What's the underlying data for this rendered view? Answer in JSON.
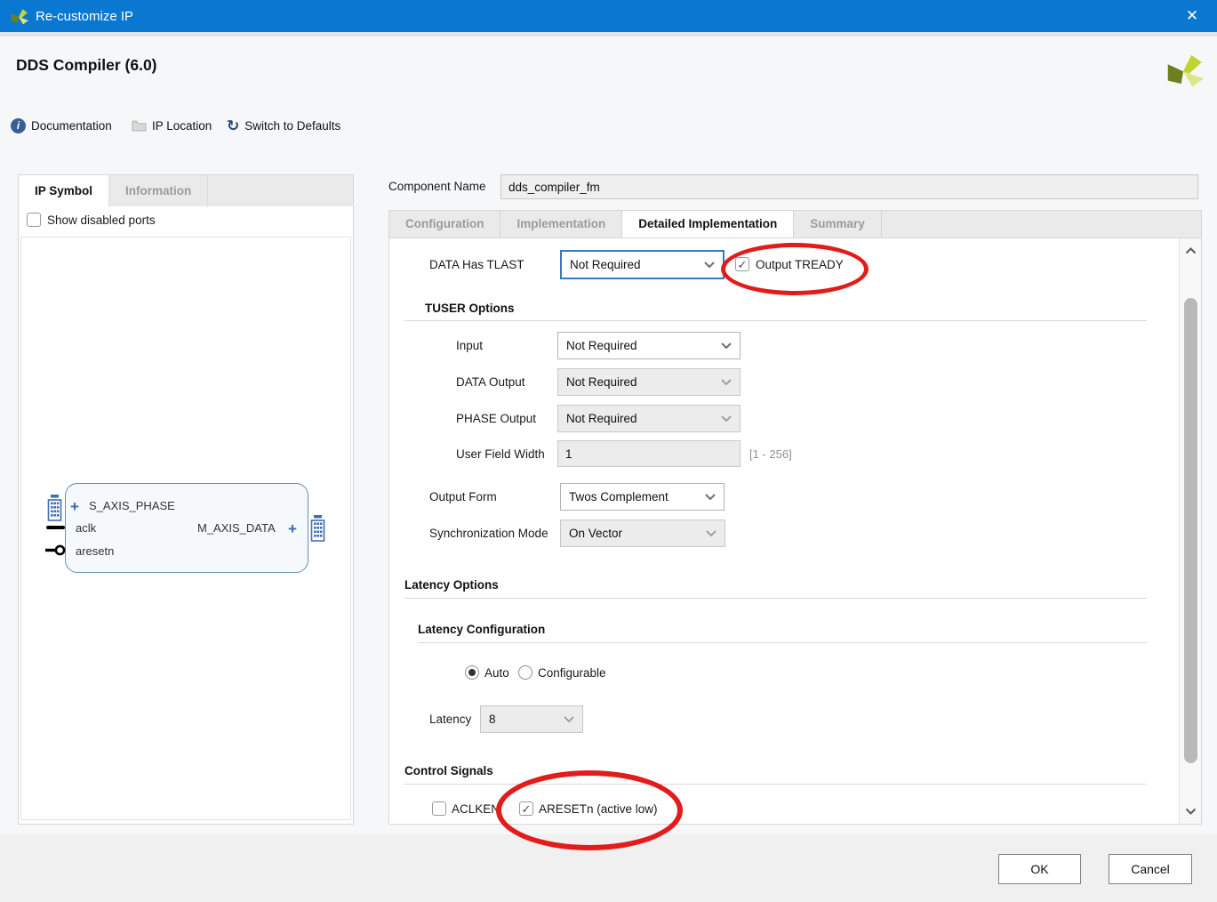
{
  "titlebar": {
    "title": "Re-customize IP"
  },
  "icons": {
    "close": "✕",
    "info": "i",
    "refresh": "↻",
    "plus": "+",
    "check": "✓"
  },
  "header": {
    "title": "DDS Compiler (6.0)"
  },
  "toolbar": {
    "documentation": "Documentation",
    "ip_location": "IP Location",
    "switch_to_defaults": "Switch to Defaults"
  },
  "left_panel": {
    "tabs": [
      {
        "label": "IP Symbol"
      },
      {
        "label": "Information"
      }
    ],
    "show_disabled_ports": "Show disabled ports",
    "ip_symbol": {
      "port_s_axis_phase": "S_AXIS_PHASE",
      "port_aclk": "aclk",
      "port_aresetn": "aresetn",
      "port_m_axis_data": "M_AXIS_DATA"
    }
  },
  "component_name": {
    "label": "Component Name",
    "value": "dds_compiler_fm"
  },
  "config_tabs": [
    {
      "label": "Configuration"
    },
    {
      "label": "Implementation"
    },
    {
      "label": "Detailed Implementation"
    },
    {
      "label": "Summary"
    }
  ],
  "form": {
    "data_has_tlast": {
      "label": "DATA Has TLAST",
      "value": "Not Required"
    },
    "output_tready": {
      "label": "Output TREADY",
      "checked": true
    },
    "tuser_options": {
      "title": "TUSER Options",
      "input": {
        "label": "Input",
        "value": "Not Required"
      },
      "data_output": {
        "label": "DATA Output",
        "value": "Not Required"
      },
      "phase_output": {
        "label": "PHASE Output",
        "value": "Not Required"
      },
      "user_field_width": {
        "label": "User Field Width",
        "value": "1",
        "range": "[1 - 256]"
      }
    },
    "output_form": {
      "label": "Output Form",
      "value": "Twos Complement"
    },
    "synchronization_mode": {
      "label": "Synchronization Mode",
      "value": "On Vector"
    },
    "latency_options": {
      "title": "Latency Options",
      "latency_configuration": {
        "title": "Latency Configuration",
        "auto_label": "Auto",
        "configurable_label": "Configurable",
        "selected": "Auto"
      },
      "latency": {
        "label": "Latency",
        "value": "8"
      }
    },
    "control_signals": {
      "title": "Control Signals",
      "aclken": {
        "label": "ACLKEN",
        "checked": false
      },
      "aresetn": {
        "label": "ARESETn (active low)",
        "checked": true
      }
    }
  },
  "footer": {
    "ok": "OK",
    "cancel": "Cancel"
  },
  "colors": {
    "titlebar_blue": "#0a78d0",
    "focus_blue": "#3a76c1",
    "annotation_red": "#e21b1b",
    "xilinx_dark_green": "#6e7f1e",
    "xilinx_green": "#c0d32e",
    "xilinx_light_green": "#dce68b"
  }
}
